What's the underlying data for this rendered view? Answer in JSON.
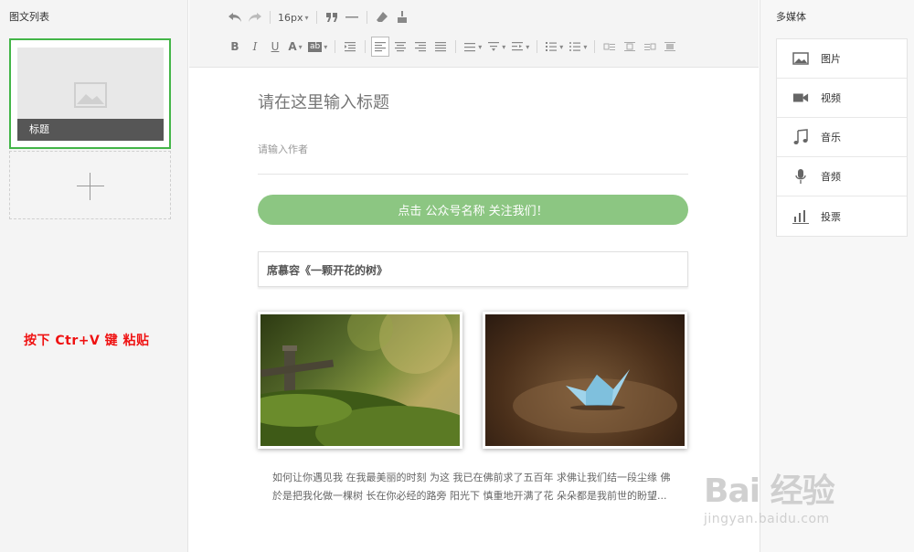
{
  "left": {
    "title": "图文列表",
    "article_caption": "标题",
    "hint": "按下 Ctr+V 键 粘贴"
  },
  "toolbar": {
    "font_size": "16px"
  },
  "editor": {
    "title_placeholder": "请在这里输入标题",
    "author_placeholder": "请输入作者",
    "follow_button": "点击 公众号名称 关注我们！",
    "article_title": "席慕容《一颗开花的树》",
    "body": "如何让你遇见我 在我最美丽的时刻 为这 我已在佛前求了五百年 求佛让我们结一段尘缘 佛於是把我化做一棵树 长在你必经的路旁 阳光下 慎重地开满了花 朵朵都是我前世的盼望..."
  },
  "right": {
    "title": "多媒体",
    "items": [
      {
        "label": "图片",
        "icon": "image-icon"
      },
      {
        "label": "视频",
        "icon": "video-icon"
      },
      {
        "label": "音乐",
        "icon": "music-icon"
      },
      {
        "label": "音频",
        "icon": "microphone-icon"
      },
      {
        "label": "投票",
        "icon": "vote-icon"
      }
    ]
  },
  "watermark": {
    "main": "Bai 经验",
    "sub": "jingyan.baidu.com"
  }
}
